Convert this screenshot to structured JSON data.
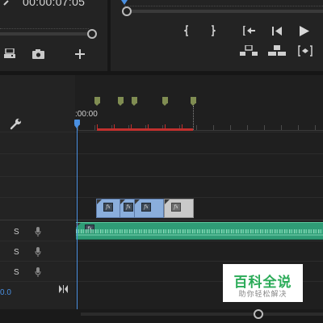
{
  "source_monitor": {
    "timecode": "00:00:07:05",
    "icons": [
      "export-frame-icon",
      "camera-icon",
      "add-icon"
    ]
  },
  "program_monitor": {
    "controls_row1": [
      "mark-in-icon",
      "mark-out-icon",
      "go-to-in-icon",
      "step-back-icon",
      "play-icon"
    ],
    "controls_row2": [
      "lift-icon",
      "extract-icon",
      "trim-icon"
    ]
  },
  "timeline": {
    "ruler_time": ":00:00",
    "wrench_icon": "wrench-icon",
    "clip_fx_label": "fx",
    "audio_rows": [
      {
        "solo_label": "S"
      },
      {
        "solo_label": "S"
      },
      {
        "solo_label": "S"
      }
    ],
    "volume_value": "0.0"
  },
  "watermark": {
    "title": "百科全说",
    "subtitle": "助你轻松解决"
  },
  "colors": {
    "accent_blue": "#4a90e2",
    "clip_blue": "#8aaedc",
    "audio_green": "#2f9c76",
    "marker_green": "#808d52",
    "work_area_red": "#c1302e"
  }
}
